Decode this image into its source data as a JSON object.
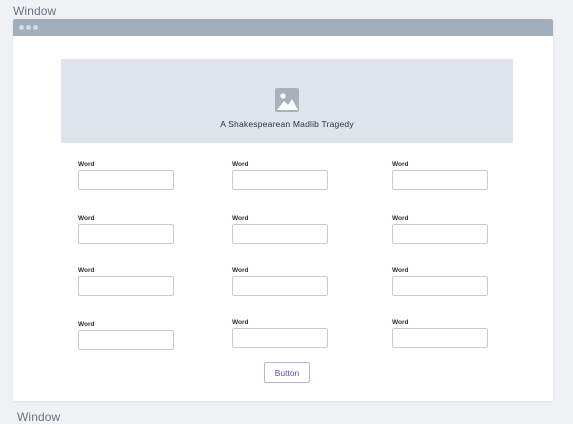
{
  "labels": {
    "top_section": "Window",
    "bottom_section": "Window"
  },
  "window": {
    "titlebar_dots": 3
  },
  "hero": {
    "icon": "image-icon",
    "caption": "A Shakespearean Madlib Tragedy"
  },
  "fields": [
    {
      "label": "Word",
      "value": "",
      "placeholder": ""
    },
    {
      "label": "Word",
      "value": "",
      "placeholder": ""
    },
    {
      "label": "Word",
      "value": "",
      "placeholder": ""
    },
    {
      "label": "Word",
      "value": "",
      "placeholder": ""
    },
    {
      "label": "Word",
      "value": "",
      "placeholder": ""
    },
    {
      "label": "Word",
      "value": "",
      "placeholder": ""
    },
    {
      "label": "Word",
      "value": "",
      "placeholder": ""
    },
    {
      "label": "Word",
      "value": "",
      "placeholder": ""
    },
    {
      "label": "Word",
      "value": "",
      "placeholder": ""
    },
    {
      "label": "Word",
      "value": "",
      "placeholder": ""
    },
    {
      "label": "Word",
      "value": "",
      "placeholder": ""
    },
    {
      "label": "Word",
      "value": "",
      "placeholder": ""
    }
  ],
  "button": {
    "label": "Button"
  },
  "colors": {
    "page_bg": "#eff1f4",
    "titlebar": "#a2afbb",
    "hero_bg": "#dfe4ea",
    "button_text": "#5a4fcf",
    "button_border": "#b9b3e6"
  }
}
